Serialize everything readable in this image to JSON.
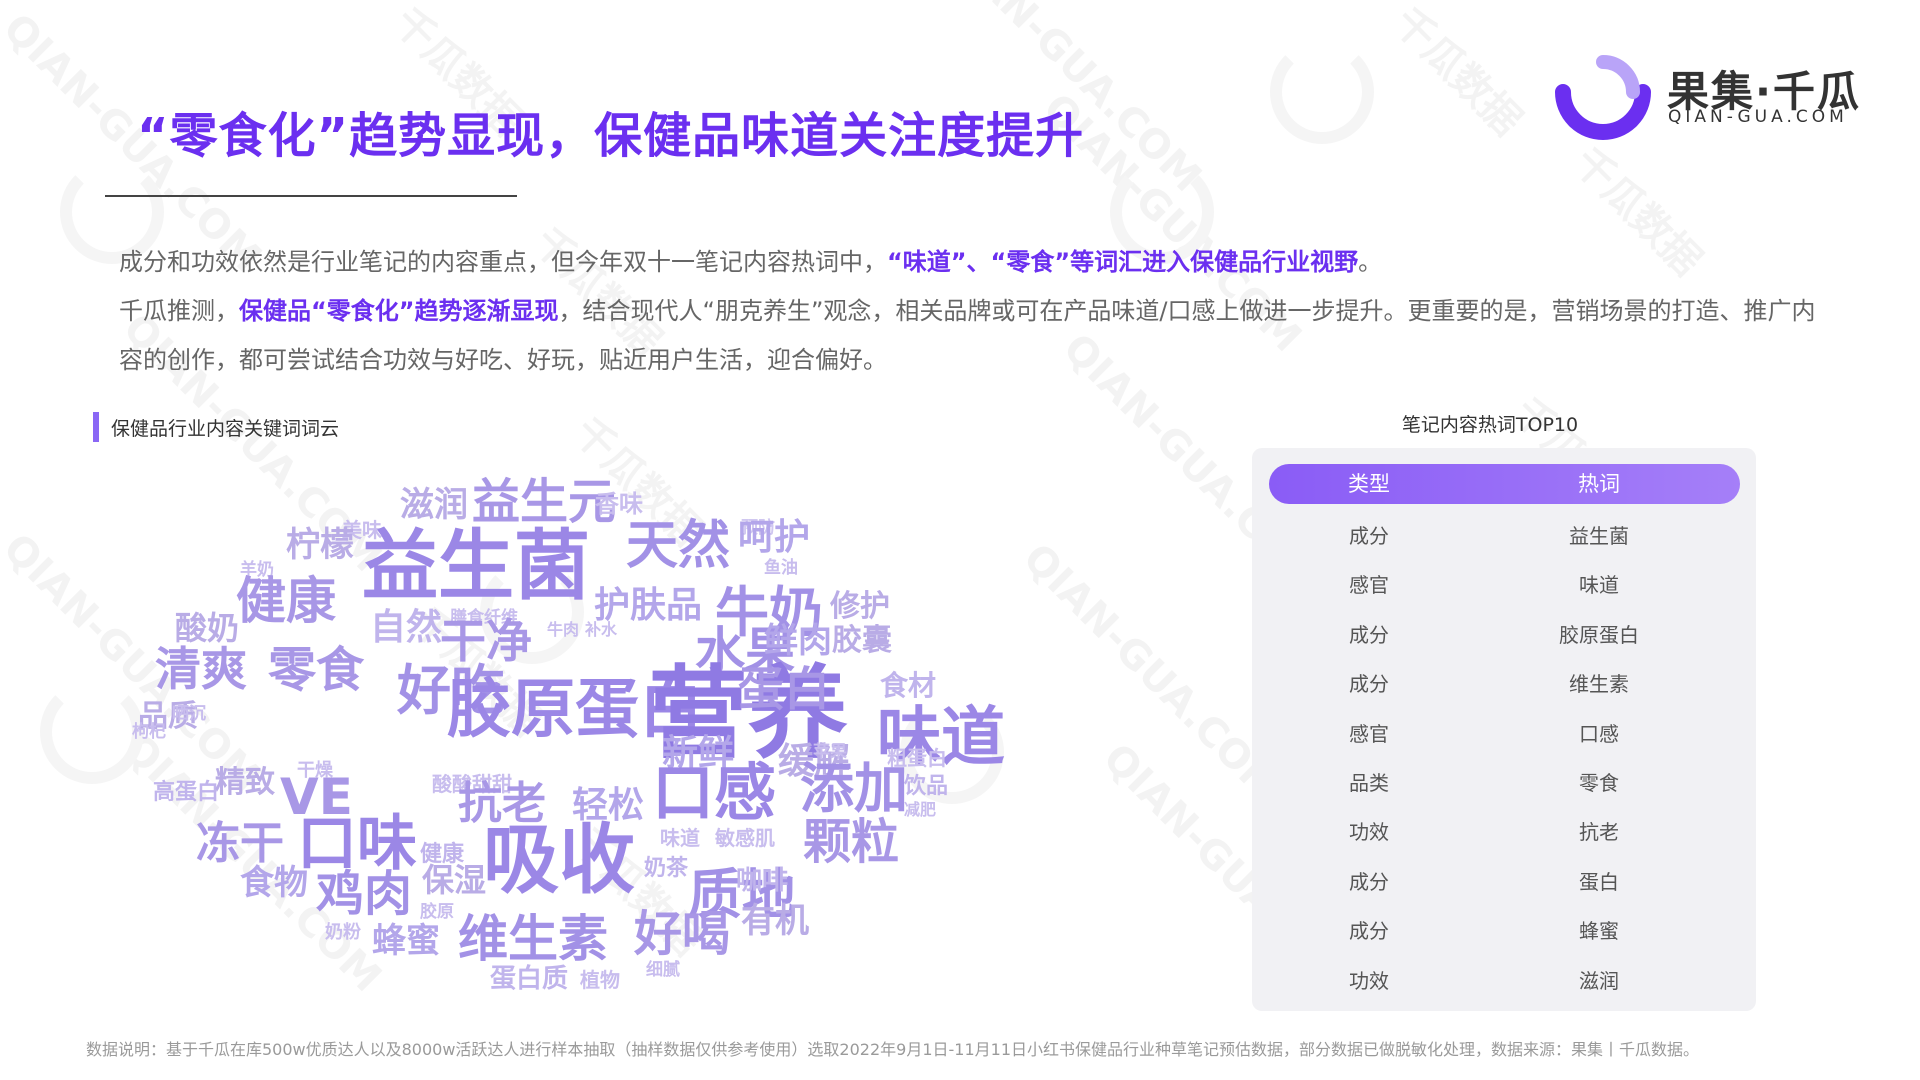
{
  "title": "“零食化”趋势显现，保健品味道关注度提升",
  "logo": {
    "cn": "果集·千瓜",
    "en": "QIAN-GUA.COM"
  },
  "watermark": {
    "cn": "千瓜数据",
    "en": "QIAN-GUA.COM"
  },
  "paragraph1": {
    "text1": "成分和功效依然是行业笔记的内容重点，但今年双十一笔记内容热词中，",
    "highlight": "“味道”、“零食”等词汇进入保健品行业视野",
    "text2": "。"
  },
  "paragraph2": {
    "text1": "千瓜推测，",
    "highlight": "保健品“零食化”趋势逐渐显现",
    "text2": "，结合现代人“朋克养生”观念，相关品牌或可在产品味道/口感上做进一步提升。更重要的是，营销场景的打造、推广内容的创作，都可尝试结合功效与好吃、好玩，贴近用户生活，迎合偏好。"
  },
  "section_label": "保健品行业内容关键词词云",
  "word_cloud": [
    {
      "text": "滋润",
      "size": 34,
      "color": "#b9ace6"
    },
    {
      "text": "益生元",
      "size": 48,
      "color": "#a897e6"
    },
    {
      "text": "香味",
      "size": 24,
      "color": "#c8bdee"
    },
    {
      "text": "美味",
      "size": 20,
      "color": "#c8bdee"
    },
    {
      "text": "预防",
      "size": 17,
      "color": "#d0c7f0"
    },
    {
      "text": "柠檬",
      "size": 34,
      "color": "#b9ace6"
    },
    {
      "text": "益生菌",
      "size": 76,
      "color": "#9b87e6"
    },
    {
      "text": "天然",
      "size": 52,
      "color": "#a291e6"
    },
    {
      "text": "呵护",
      "size": 36,
      "color": "#b3a6ea"
    },
    {
      "text": "羊奶",
      "size": 17,
      "color": "#c8bdee"
    },
    {
      "text": "鱼油",
      "size": 17,
      "color": "#c8bdee"
    },
    {
      "text": "健康",
      "size": 50,
      "color": "#a897e6"
    },
    {
      "text": "自然",
      "size": 36,
      "color": "#c0b4ec"
    },
    {
      "text": "膳食纤维",
      "size": 17,
      "color": "#c8bdee"
    },
    {
      "text": "护肤品",
      "size": 36,
      "color": "#b3a6ea"
    },
    {
      "text": "牛奶",
      "size": 54,
      "color": "#a291e6"
    },
    {
      "text": "修护",
      "size": 30,
      "color": "#b9ace6"
    },
    {
      "text": "酸奶",
      "size": 32,
      "color": "#b9ace6"
    },
    {
      "text": "干净",
      "size": 46,
      "color": "#a897e6"
    },
    {
      "text": "牛肉",
      "size": 16,
      "color": "#c8bdee"
    },
    {
      "text": "补水",
      "size": 16,
      "color": "#c8bdee"
    },
    {
      "text": "水果",
      "size": 50,
      "color": "#a291e6"
    },
    {
      "text": "鲜肉",
      "size": 34,
      "color": "#b3a6ea"
    },
    {
      "text": "胶囊",
      "size": 30,
      "color": "#b9ace6"
    },
    {
      "text": "清爽",
      "size": 46,
      "color": "#a897e6"
    },
    {
      "text": "零食",
      "size": 48,
      "color": "#a897e6"
    },
    {
      "text": "好吃",
      "size": 54,
      "color": "#a291e6"
    },
    {
      "text": "食材",
      "size": 28,
      "color": "#c0b4ec"
    },
    {
      "text": "品质",
      "size": 30,
      "color": "#b9ace6"
    },
    {
      "text": "枸杞",
      "size": 17,
      "color": "#c8bdee"
    },
    {
      "text": "晒沉",
      "size": 17,
      "color": "#c8bdee"
    },
    {
      "text": "胶原蛋白",
      "size": 64,
      "color": "#9b87e6"
    },
    {
      "text": "营养",
      "size": 100,
      "color": "#8f7ae3"
    },
    {
      "text": "蛋白",
      "size": 46,
      "color": "#a897e6"
    },
    {
      "text": "味道",
      "size": 64,
      "color": "#9b87e6"
    },
    {
      "text": "新鲜",
      "size": 36,
      "color": "#b3a6ea"
    },
    {
      "text": "缓解",
      "size": 36,
      "color": "#b9ace6"
    },
    {
      "text": "苹果",
      "size": 17,
      "color": "#c8bdee"
    },
    {
      "text": "粗蛋白",
      "size": 20,
      "color": "#c8bdee"
    },
    {
      "text": "高蛋白",
      "size": 22,
      "color": "#c0b4ec"
    },
    {
      "text": "精致",
      "size": 30,
      "color": "#b9ace6"
    },
    {
      "text": "VE",
      "size": 50,
      "color": "#a897e6"
    },
    {
      "text": "酸酸甜甜",
      "size": 20,
      "color": "#c8bdee"
    },
    {
      "text": "干燥",
      "size": 18,
      "color": "#c8bdee"
    },
    {
      "text": "口感",
      "size": 62,
      "color": "#9b87e6"
    },
    {
      "text": "添加",
      "size": 54,
      "color": "#a291e6"
    },
    {
      "text": "饮品",
      "size": 22,
      "color": "#c0b4ec"
    },
    {
      "text": "抗老",
      "size": 44,
      "color": "#a897e6"
    },
    {
      "text": "轻松",
      "size": 36,
      "color": "#b3a6ea"
    },
    {
      "text": "减肥",
      "size": 16,
      "color": "#c8bdee"
    },
    {
      "text": "冻干",
      "size": 44,
      "color": "#a897e6"
    },
    {
      "text": "口味",
      "size": 60,
      "color": "#9b87e6"
    },
    {
      "text": "健康",
      "size": 22,
      "color": "#c0b4ec"
    },
    {
      "text": "吸收",
      "size": 76,
      "color": "#9b87e6"
    },
    {
      "text": "味道",
      "size": 20,
      "color": "#c8bdee"
    },
    {
      "text": "敏感肌",
      "size": 20,
      "color": "#c8bdee"
    },
    {
      "text": "颗粒",
      "size": 48,
      "color": "#a897e6"
    },
    {
      "text": "食物",
      "size": 34,
      "color": "#b3a6ea"
    },
    {
      "text": "鸡肉",
      "size": 48,
      "color": "#a291e6"
    },
    {
      "text": "保湿",
      "size": 32,
      "color": "#b9ace6"
    },
    {
      "text": "奶茶",
      "size": 22,
      "color": "#c0b4ec"
    },
    {
      "text": "质地",
      "size": 54,
      "color": "#a291e6"
    },
    {
      "text": "咖啡",
      "size": 26,
      "color": "#c0b4ec"
    },
    {
      "text": "胶原",
      "size": 17,
      "color": "#c8bdee"
    },
    {
      "text": "奶粉",
      "size": 18,
      "color": "#c8bdee"
    },
    {
      "text": "蜂蜜",
      "size": 34,
      "color": "#b3a6ea"
    },
    {
      "text": "维生素",
      "size": 50,
      "color": "#a291e6"
    },
    {
      "text": "好喝",
      "size": 48,
      "color": "#a897e6"
    },
    {
      "text": "有机",
      "size": 34,
      "color": "#b9ace6"
    },
    {
      "text": "蛋白质",
      "size": 26,
      "color": "#c0b4ec"
    },
    {
      "text": "植物",
      "size": 20,
      "color": "#c8bdee"
    },
    {
      "text": "细腻",
      "size": 17,
      "color": "#c8bdee"
    }
  ],
  "table": {
    "title": "笔记内容热词TOP10",
    "headers": [
      "类型",
      "热词"
    ],
    "rows": [
      [
        "成分",
        "益生菌"
      ],
      [
        "感官",
        "味道"
      ],
      [
        "成分",
        "胶原蛋白"
      ],
      [
        "成分",
        "维生素"
      ],
      [
        "感官",
        "口感"
      ],
      [
        "品类",
        "零食"
      ],
      [
        "功效",
        "抗老"
      ],
      [
        "成分",
        "蛋白"
      ],
      [
        "成分",
        "蜂蜜"
      ],
      [
        "功效",
        "滋润"
      ]
    ]
  },
  "footnote": "数据说明：基于千瓜在库500w优质达人以及8000w活跃达人进行样本抽取（抽样数据仅供参考使用）选取2022年9月1日-11月11日小红书保健品行业种草笔记预估数据，部分数据已做脱敏化处理，数据来源：果集丨千瓜数据。",
  "colors": {
    "accent": "#6b2ff0",
    "table_header": "#8a5cf6"
  }
}
